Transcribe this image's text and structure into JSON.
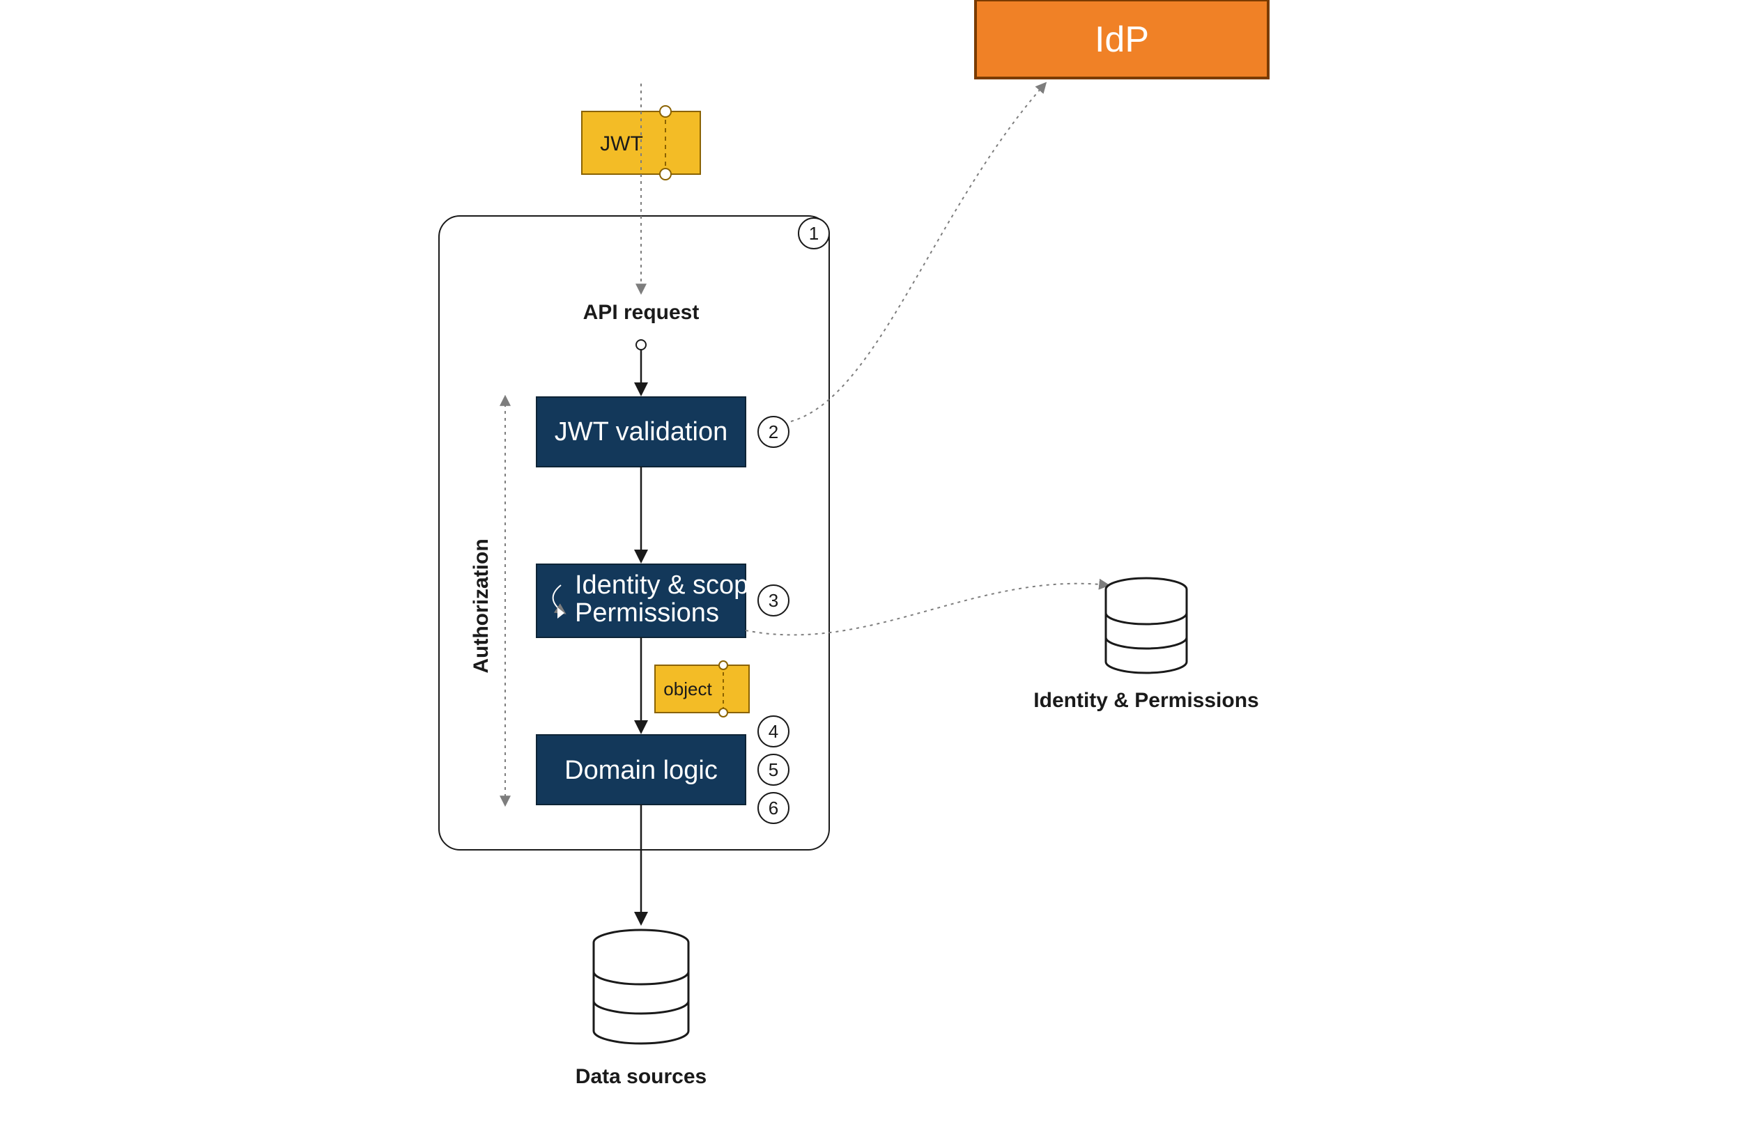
{
  "nodes": {
    "idp": "IdP",
    "jwt_token": "JWT",
    "api_request": "API request",
    "jwt_validation": "JWT validation",
    "identity_line1": "Identity & scope",
    "identity_line2": "Permissions",
    "object_token": "object",
    "domain_logic": "Domain logic",
    "authorization_label": "Authorization",
    "data_sources": "Data sources",
    "identity_db": "Identity & Permissions"
  },
  "steps": {
    "s1": "1",
    "s2": "2",
    "s3": "3",
    "s4": "4",
    "s5": "5",
    "s6": "6"
  }
}
